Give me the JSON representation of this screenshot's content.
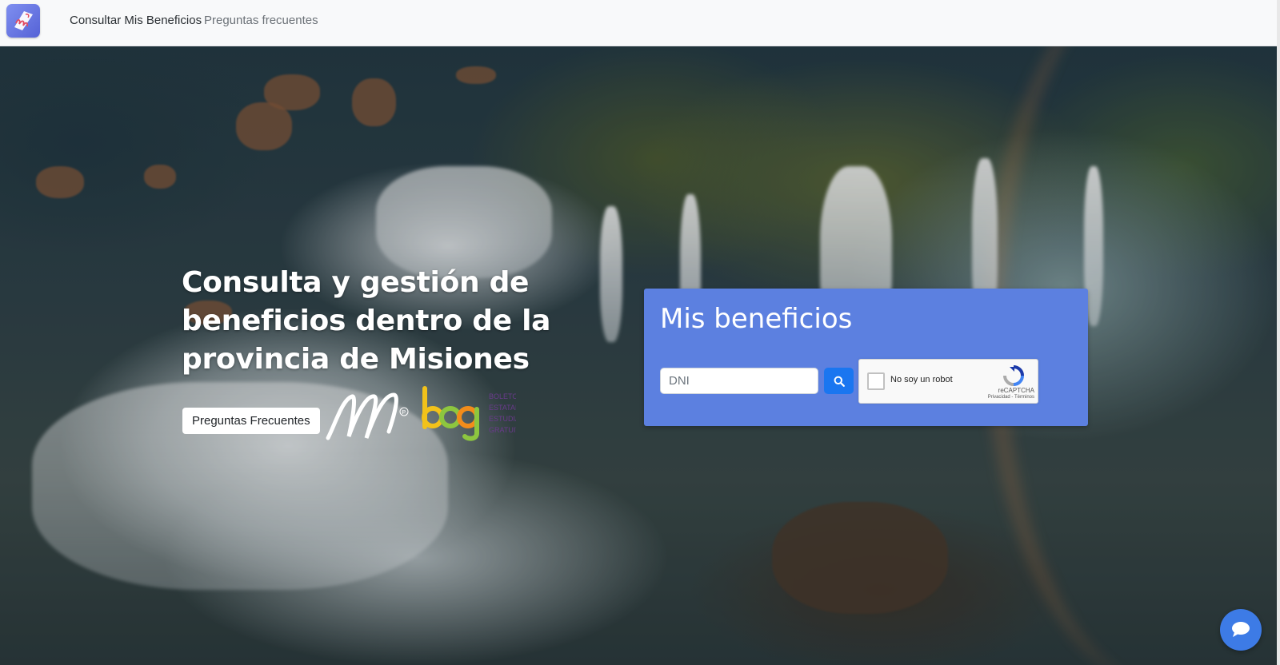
{
  "navbar": {
    "brand_icon": "misiones-app-logo",
    "links": [
      {
        "label": "Consultar Mis Beneficios",
        "active": true
      },
      {
        "label": "Preguntas frecuentes",
        "active": false
      }
    ]
  },
  "hero": {
    "headline": "Consulta y gestión de beneficios dentro de la provincia de Misiones",
    "faq_button_label": "Preguntas Frecuentes",
    "logos": [
      {
        "icon": "misiones-m-logo",
        "text": ""
      },
      {
        "icon": "beeg-logo",
        "text": "beeg",
        "caption": [
          "BOLETO",
          "ESTATAL",
          "ESTUDIANTIL",
          "GRATUITO"
        ]
      }
    ]
  },
  "card": {
    "title": "Mis beneficios",
    "dni_placeholder": "DNI",
    "dni_value": "",
    "search_icon": "search-icon",
    "captcha": {
      "label": "No soy un robot",
      "brand": "reCAPTCHA",
      "terms": "Privacidad - Términos",
      "checked": false
    }
  },
  "chat": {
    "icon": "chat-bubble-icon"
  },
  "colors": {
    "card_bg": "#5c80e0",
    "search_button": "#1a76f0",
    "chat_button": "#3d7be6",
    "navbar_bg": "#f8f9fa"
  }
}
